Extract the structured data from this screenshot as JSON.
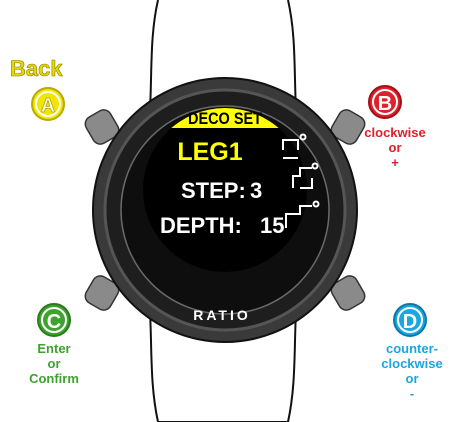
{
  "screen": {
    "header": "DECO SET",
    "title": "LEG1",
    "step_label": "STEP:",
    "step_value": "3",
    "depth_label": "DEPTH:",
    "depth_value": "15"
  },
  "bezel_brand": "RATIO",
  "buttons": {
    "a": {
      "letter": "A",
      "label": "Back",
      "color": "#e6d800"
    },
    "b": {
      "letter": "B",
      "lines": [
        "clockwise",
        "or",
        "+"
      ],
      "color": "#e0202a"
    },
    "c": {
      "letter": "C",
      "lines": [
        "Enter",
        "or",
        "Confirm"
      ],
      "color": "#3ea32e"
    },
    "d": {
      "letter": "D",
      "lines": [
        "counter-",
        "clockwise",
        "or",
        "-"
      ],
      "color": "#1aa6e0"
    }
  },
  "colors": {
    "screen_header": "#ffff00",
    "screen_title": "#ffff00",
    "screen_text": "#ffffff",
    "bezel": "#2a2a2a",
    "strap": "#ffffff"
  },
  "icons": [
    "deco-stop-icon",
    "deco-stop-icon",
    "deco-stop-icon"
  ]
}
